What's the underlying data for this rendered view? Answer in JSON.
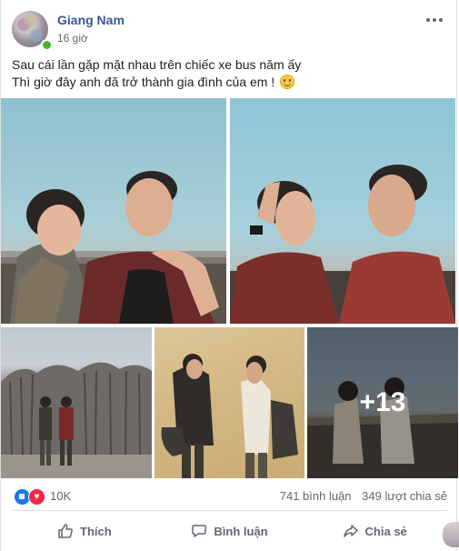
{
  "post": {
    "author": "Giang Nam",
    "time": "16 giờ",
    "text_line1": "Sau cái lần gặp mặt nhau trên chiếc xe bus năm ấy",
    "text_line2": "Thì giờ đây anh đã trở thành gia đình của em !",
    "more_photos": "+13"
  },
  "stats": {
    "reactions": "10K",
    "comments": "741 bình luận",
    "shares": "349 lượt chia sẻ"
  },
  "actions": {
    "like": "Thích",
    "comment": "Bình luận",
    "share": "Chia sẻ"
  },
  "icons": {
    "like": "thumbs-up-icon",
    "comment": "speech-bubble-icon",
    "share": "share-arrow-icon",
    "more": "ellipsis-icon",
    "emoji": "smile-emoji-icon"
  },
  "colors": {
    "author": "#385898",
    "like_reaction": "#1877f2",
    "love_reaction": "#f0284a",
    "online": "#42b72a"
  }
}
